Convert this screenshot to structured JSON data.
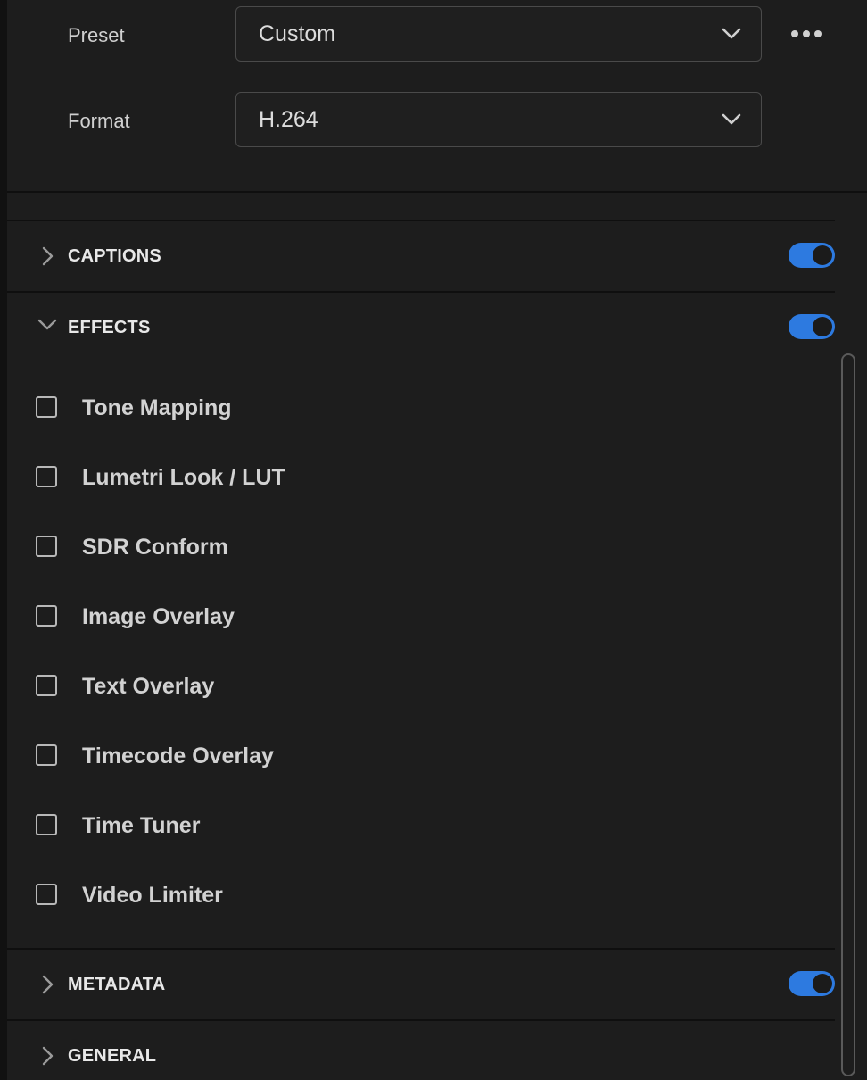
{
  "export_settings": {
    "preset": {
      "label": "Preset",
      "value": "Custom"
    },
    "format": {
      "label": "Format",
      "value": "H.264"
    },
    "more_icon": "more-horizontal-icon"
  },
  "sections": {
    "captions": {
      "title": "CAPTIONS",
      "expanded": false,
      "enabled": true
    },
    "effects": {
      "title": "EFFECTS",
      "expanded": true,
      "enabled": true,
      "items": [
        {
          "label": "Tone Mapping",
          "checked": false
        },
        {
          "label": "Lumetri Look / LUT",
          "checked": false
        },
        {
          "label": "SDR Conform",
          "checked": false
        },
        {
          "label": "Image Overlay",
          "checked": false
        },
        {
          "label": "Text Overlay",
          "checked": false
        },
        {
          "label": "Timecode Overlay",
          "checked": false
        },
        {
          "label": "Time Tuner",
          "checked": false
        },
        {
          "label": "Video Limiter",
          "checked": false
        }
      ]
    },
    "metadata": {
      "title": "METADATA",
      "expanded": false,
      "enabled": true
    },
    "general": {
      "title": "GENERAL",
      "expanded": false
    }
  },
  "colors": {
    "background": "#1d1d1d",
    "toggle_on": "#2d7ae0",
    "divider": "#0f0f0f"
  }
}
